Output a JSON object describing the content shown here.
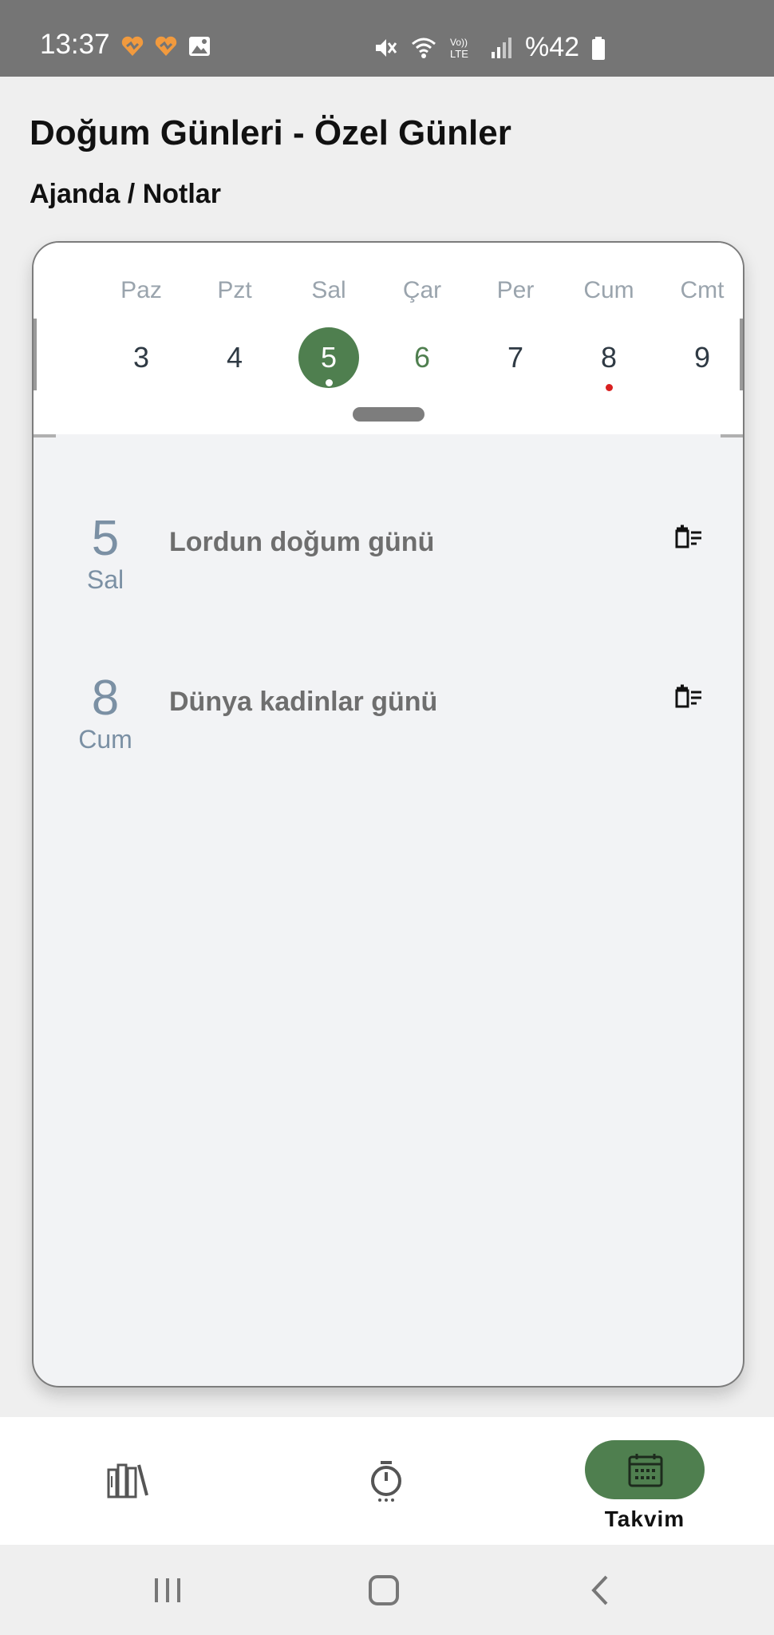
{
  "status_bar": {
    "time": "13:37",
    "battery_text": "%42",
    "notification_icons": [
      "heart-app-icon",
      "heart-app-icon",
      "image-icon"
    ],
    "system_icons": [
      "mute-icon",
      "wifi-icon",
      "volte-icon",
      "signal-icon",
      "battery-icon"
    ],
    "volte_label": "Vo)) LTE"
  },
  "header": {
    "title": "Doğum Günleri - Özel Günler",
    "subtitle": "Ajanda / Notlar"
  },
  "week": {
    "days": [
      {
        "name": "Paz",
        "num": "3",
        "state": "normal"
      },
      {
        "name": "Pzt",
        "num": "4",
        "state": "normal"
      },
      {
        "name": "Sal",
        "num": "5",
        "state": "selected"
      },
      {
        "name": "Çar",
        "num": "6",
        "state": "today"
      },
      {
        "name": "Per",
        "num": "7",
        "state": "normal"
      },
      {
        "name": "Cum",
        "num": "8",
        "state": "event"
      },
      {
        "name": "Cmt",
        "num": "9",
        "state": "normal"
      }
    ]
  },
  "events": [
    {
      "day_num": "5",
      "day_name": "Sal",
      "title": "Lordun doğum günü"
    },
    {
      "day_num": "8",
      "day_name": "Cum",
      "title": "Dünya kadinlar günü"
    }
  ],
  "bottom_nav": {
    "items": [
      {
        "icon": "library-icon",
        "label": ""
      },
      {
        "icon": "timer-icon",
        "label": ""
      },
      {
        "icon": "calendar-icon",
        "label": "Takvim",
        "active": true
      }
    ]
  },
  "colors": {
    "accent": "#4f7f4f",
    "event_dot": "#d92020",
    "status_bar": "#757575"
  }
}
